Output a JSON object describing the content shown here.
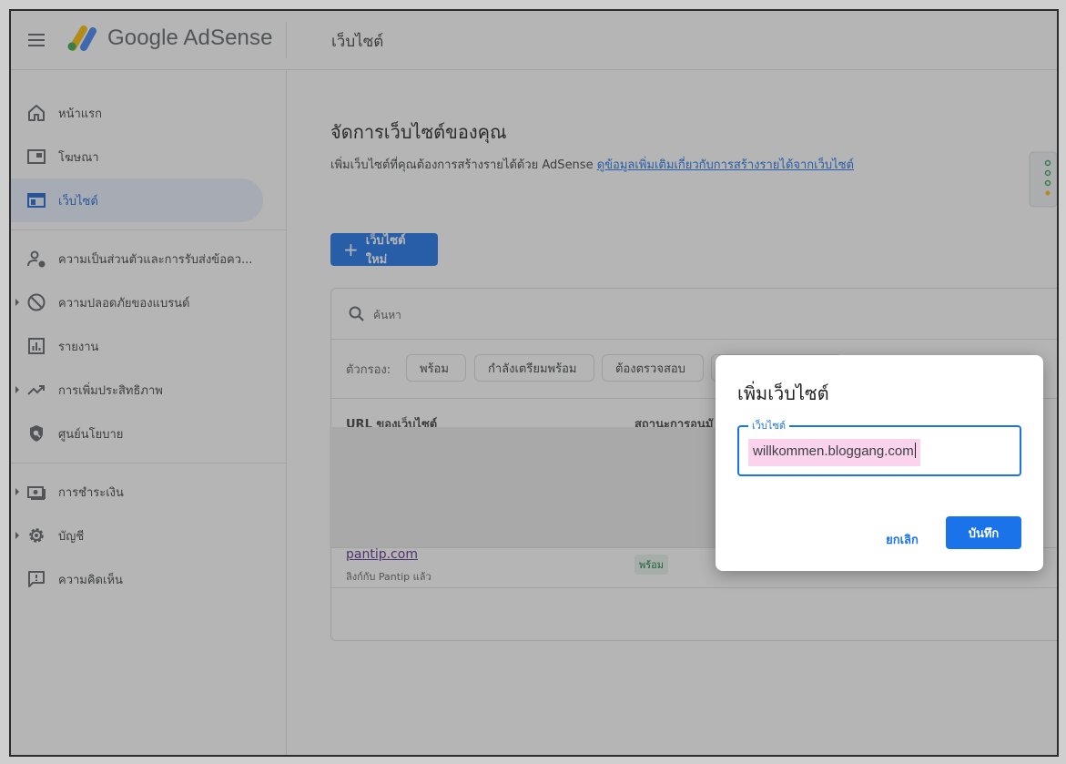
{
  "header": {
    "app_name": "Google AdSense",
    "page_title": "เว็บไซต์"
  },
  "sidebar": {
    "items": [
      {
        "label": "หน้าแรก",
        "icon": "home-icon"
      },
      {
        "label": "โฆษณา",
        "icon": "ads-icon"
      },
      {
        "label": "เว็บไซต์",
        "icon": "sites-icon",
        "active": true
      },
      {
        "label": "ความเป็นส่วนตัวและการรับส่งข้อคว...",
        "icon": "privacy-icon"
      },
      {
        "label": "ความปลอดภัยของแบรนด์",
        "icon": "block-icon"
      },
      {
        "label": "รายงาน",
        "icon": "reports-icon"
      },
      {
        "label": "การเพิ่มประสิทธิภาพ",
        "icon": "trending-icon"
      },
      {
        "label": "ศูนย์นโยบาย",
        "icon": "policy-icon"
      },
      {
        "label": "การชำระเงิน",
        "icon": "payments-icon"
      },
      {
        "label": "บัญชี",
        "icon": "gear-icon"
      },
      {
        "label": "ความคิดเห็น",
        "icon": "feedback-icon"
      }
    ]
  },
  "main": {
    "title": "จัดการเว็บไซต์ของคุณ",
    "description": "เพิ่มเว็บไซต์ที่คุณต้องการสร้างรายได้ด้วย AdSense",
    "learn_more_link": "ดูข้อมูลเพิ่มเติมเกี่ยวกับการสร้างรายได้จากเว็บไซต์",
    "new_site_button": "เว็บไซต์ใหม่",
    "search_placeholder": "ค้นหา",
    "filter_label": "ตัวกรอง:",
    "filters": [
      "พร้อม",
      "กำลังเตรียมพร้อม",
      "ต้องตรวจสอบ"
    ],
    "columns": [
      "URL ของเว็บไซต์",
      "สถานะการอนุมั"
    ],
    "rows": [
      {
        "site": "pantip.com",
        "sub": "ลิงก์กับ Pantip แล้ว",
        "status": "พร้อม"
      }
    ]
  },
  "dialog": {
    "title": "เพิ่มเว็บไซต์",
    "field_label": "เว็บไซต์",
    "field_value": "willkommen.bloggang.com",
    "cancel_label": "ยกเลิก",
    "save_label": "บันทึก"
  },
  "colors": {
    "accent": "#1a73e8",
    "active_bg": "#e8f0fe",
    "highlight": "#fbd3ec",
    "ready_bg": "#e6f4ea"
  }
}
